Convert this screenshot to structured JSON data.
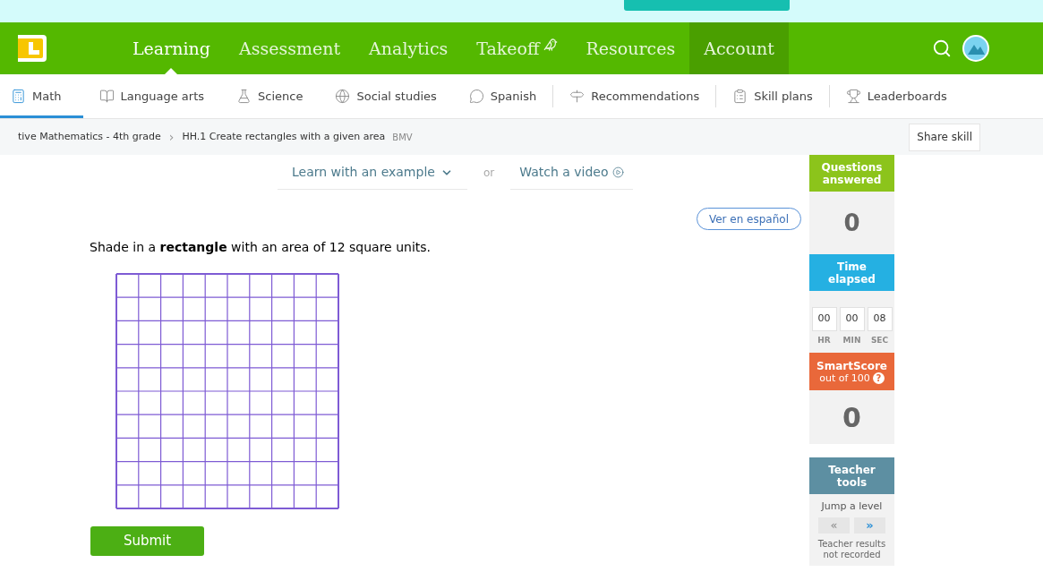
{
  "top_nav": {
    "items": [
      {
        "label": "Learning",
        "selected": true,
        "kind": "plain"
      },
      {
        "label": "Assessment",
        "selected": false,
        "kind": "plain"
      },
      {
        "label": "Analytics",
        "selected": false,
        "kind": "plain"
      },
      {
        "label": "Takeoff",
        "selected": false,
        "kind": "bird"
      },
      {
        "label": "Resources",
        "selected": false,
        "kind": "plain"
      },
      {
        "label": "Account",
        "selected": false,
        "kind": "highlighted"
      }
    ]
  },
  "subjects": [
    {
      "label": "Math",
      "selected": true,
      "kind": "math"
    },
    {
      "label": "Language arts",
      "selected": false,
      "kind": "book"
    },
    {
      "label": "Science",
      "selected": false,
      "kind": "flask"
    },
    {
      "label": "Social studies",
      "selected": false,
      "kind": "globe"
    },
    {
      "label": "Spanish",
      "selected": false,
      "kind": "chat"
    },
    {
      "label": "Recommendations",
      "selected": false,
      "kind": "signpost"
    },
    {
      "label": "Skill plans",
      "selected": false,
      "kind": "clipboard"
    },
    {
      "label": "Leaderboards",
      "selected": false,
      "kind": "trophy"
    }
  ],
  "breadcrumb": {
    "course": "tive Mathematics - 4th grade",
    "separator": "›",
    "skill": "HH.1 Create rectangles with a given area",
    "code": "BMV",
    "share": "Share skill"
  },
  "help": {
    "example": "Learn with an example",
    "or": "or",
    "video": "Watch a video"
  },
  "language_button": "Ver en español",
  "question": "Shade in a **rectangle** with an area of 12 square units.",
  "submit": "Submit",
  "sidebar": {
    "questions_title": "Questions answered",
    "questions_value": "0",
    "time_title": "Time elapsed",
    "time": [
      {
        "value": "00",
        "unit": "HR"
      },
      {
        "value": "00",
        "unit": "MIN"
      },
      {
        "value": "08",
        "unit": "SEC"
      }
    ],
    "score_title": "SmartScore",
    "score_sub": "out of 100",
    "help_mark": "?",
    "score_value": "0",
    "teacher_title": "Teacher tools",
    "jump": "Jump a level",
    "jump_buttons": [
      {
        "label": "«",
        "disabled": true
      },
      {
        "label": "»",
        "disabled": false
      }
    ],
    "note": "Teacher results not recorded"
  }
}
